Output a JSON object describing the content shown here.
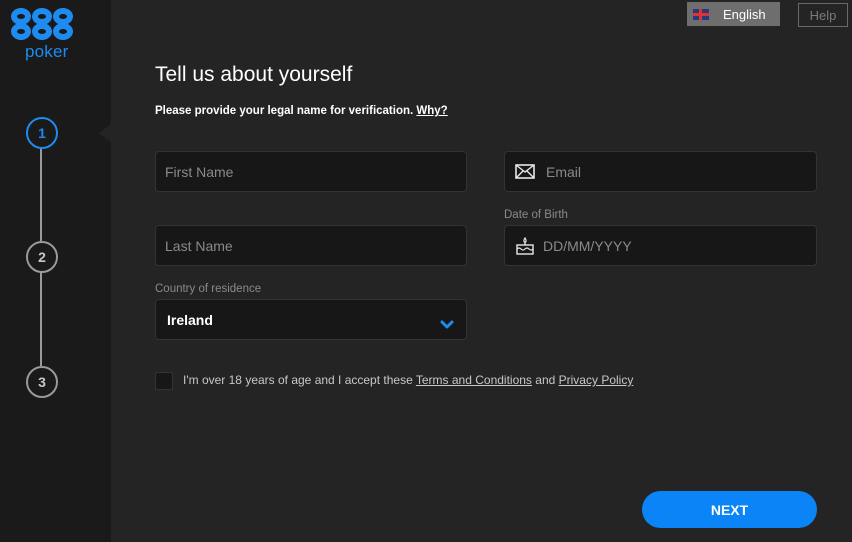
{
  "brand": {
    "logo_number": "888",
    "logo_text": "poker",
    "accent_color": "#1e8bf0"
  },
  "header": {
    "language_label": "English",
    "language_flag": "uk-flag-icon",
    "help_label": "Help"
  },
  "stepper": {
    "steps": [
      "1",
      "2",
      "3"
    ],
    "active_step": 1
  },
  "form": {
    "title": "Tell us about yourself",
    "subtitle": "Please provide your legal name for verification.",
    "why_link": "Why?",
    "first_name": {
      "placeholder": "First Name",
      "value": ""
    },
    "last_name": {
      "placeholder": "Last Name",
      "value": ""
    },
    "email": {
      "placeholder": "Email",
      "value": "",
      "icon": "envelope-icon"
    },
    "dob": {
      "label": "Date of Birth",
      "placeholder": "DD/MM/YYYY",
      "value": "",
      "icon": "birthday-cake-icon"
    },
    "country": {
      "label": "Country of residence",
      "value": "Ireland"
    },
    "terms": {
      "checked": false,
      "text_prefix": "I'm over 18 years of age and I accept these ",
      "terms_link": "Terms and Conditions",
      "text_mid": " and ",
      "privacy_link": "Privacy Policy"
    },
    "next_label": "NEXT"
  }
}
